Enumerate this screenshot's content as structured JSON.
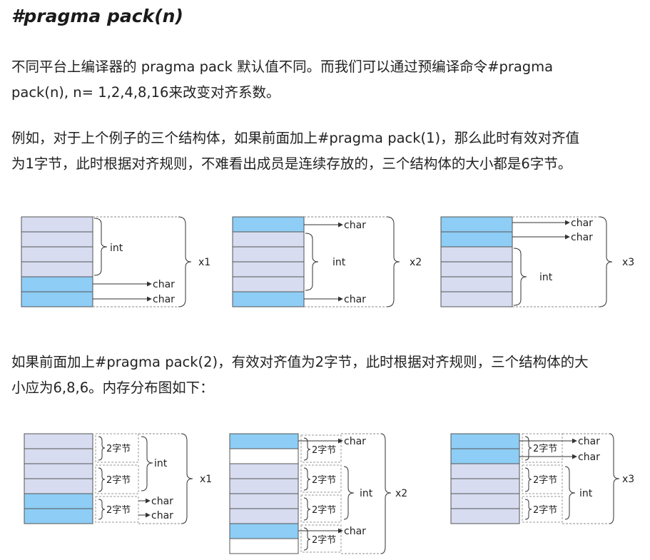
{
  "heading": "#pragma pack(n)",
  "para1_line1": "不同平台上编译器的 pragma pack 默认值不同。而我们可以通过预编译命令#pragma",
  "para1_line2": "pack(n), n= 1,2,4,8,16来改变对齐系数。",
  "para2_line1": "例如，对于上个例子的三个结构体，如果前面加上#pragma pack(1)，那么此时有效对齐值",
  "para2_line2": "为1字节，此时根据对齐规则，不难看出成员是连续存放的，三个结构体的大小都是6字节。",
  "para3_line1": "如果前面加上#pragma pack(2)，有效对齐值为2字节，此时根据对齐规则，三个结构体的大",
  "para3_line2": "小应为6,8,6。内存分布图如下：",
  "figure1": {
    "labels": {
      "int": "int",
      "char": "char",
      "x1": "x1",
      "x2": "x2",
      "x3": "x3"
    }
  },
  "figure2": {
    "labels": {
      "int": "int",
      "char": "char",
      "two_bytes": "2字节",
      "x1": "x1",
      "x2": "x2",
      "x3": "x3"
    }
  },
  "colors": {
    "blue": "#8ecdf5",
    "lavender": "#d8dcf0",
    "border": "#555555",
    "text": "#222222"
  }
}
